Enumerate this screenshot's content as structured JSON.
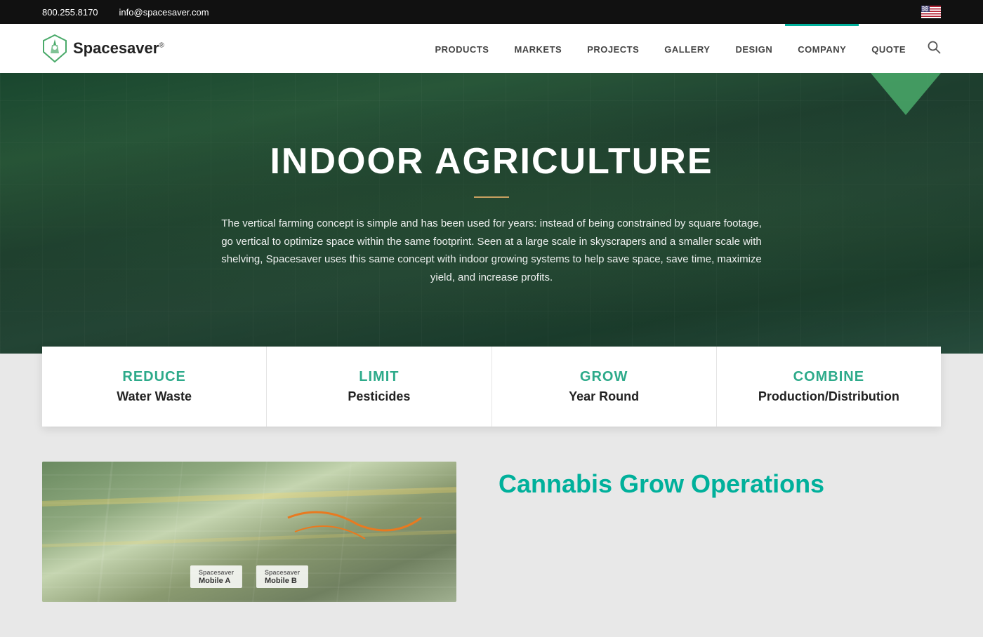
{
  "topbar": {
    "phone": "800.255.8170",
    "email": "info@spacesaver.com"
  },
  "navbar": {
    "logo_text": "Spacesaver",
    "logo_sup": "®",
    "nav_items": [
      {
        "label": "PRODUCTS",
        "href": "#"
      },
      {
        "label": "MARKETS",
        "href": "#"
      },
      {
        "label": "PROJECTS",
        "href": "#"
      },
      {
        "label": "GALLERY",
        "href": "#"
      },
      {
        "label": "DESIGN",
        "href": "#"
      },
      {
        "label": "COMPANY",
        "href": "#",
        "active": true
      },
      {
        "label": "QUOTE",
        "href": "#"
      }
    ]
  },
  "hero": {
    "title": "INDOOR AGRICULTURE",
    "description": "The vertical farming concept is simple and has been used for years: instead of being constrained by square footage, go vertical to optimize space within the same footprint. Seen at a large scale in skyscrapers and a smaller scale with shelving, Spacesaver uses this same concept with indoor growing systems to help save space, save time, maximize yield, and increase profits."
  },
  "features": [
    {
      "label": "REDUCE",
      "sublabel": "Water Waste"
    },
    {
      "label": "LIMIT",
      "sublabel": "Pesticides"
    },
    {
      "label": "GROW",
      "sublabel": "Year Round"
    },
    {
      "label": "COMBINE",
      "sublabel": "Production/Distribution"
    }
  ],
  "bottom": {
    "title": "Cannabis Grow Operations",
    "image_badges": [
      "Mobile A",
      "Mobile B"
    ]
  }
}
